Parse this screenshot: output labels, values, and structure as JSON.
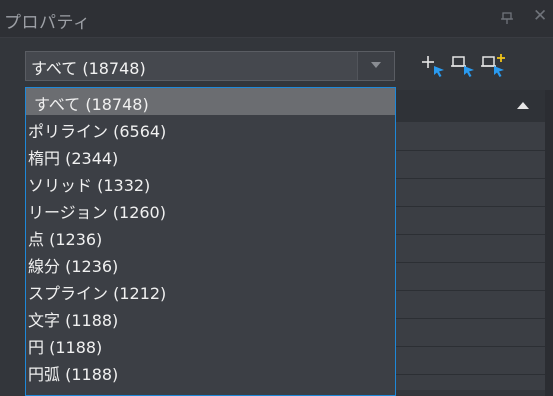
{
  "window": {
    "title": "プロパティ",
    "pin_icon": "pin-icon",
    "close_label": "✕"
  },
  "filter": {
    "selected": "すべて (18748)",
    "options": [
      "すべて (18748)",
      "ポリライン (6564)",
      "楕円 (2344)",
      "ソリッド (1332)",
      "リージョン (1260)",
      "点 (1236)",
      "線分 (1236)",
      "スプライン (1212)",
      "文字 (1188)",
      "円 (1188)",
      "円弧 (1188)"
    ],
    "highlighted_index": 0
  },
  "toolbar": {
    "icons": [
      "add-select-icon",
      "quick-select-icon",
      "toggle-pickadd-icon"
    ],
    "accent": "#2a9bf0",
    "add_color": "#f0c419"
  },
  "colors": {
    "highlight": "#1e88d8",
    "panel": "#33363b"
  }
}
